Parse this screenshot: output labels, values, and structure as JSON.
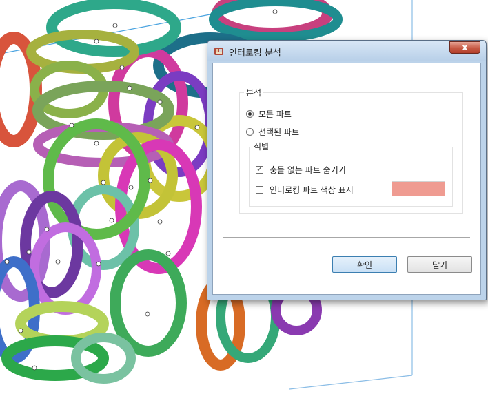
{
  "dialog": {
    "title": "인터로킹 분석",
    "close_glyph": "x",
    "analysis_group_label": "분석",
    "radio_all_parts": "모든 파트",
    "radio_selected_parts": "선택된 파트",
    "display_group_label": "식별",
    "checkbox_hide_unrelated": "충돌 없는 파트 숨기기",
    "checkbox_show_interlock_color": "인터로킹 파트 색상 표시",
    "interlock_color": "#ef9b91",
    "ok_label": "확인",
    "close_label": "닫기"
  },
  "state": {
    "selected_radio": "all_parts",
    "hide_unrelated_checked": true,
    "show_color_checked": false
  },
  "icons": {
    "title_icon": "app-cube-icon",
    "check_glyph": "✓"
  }
}
